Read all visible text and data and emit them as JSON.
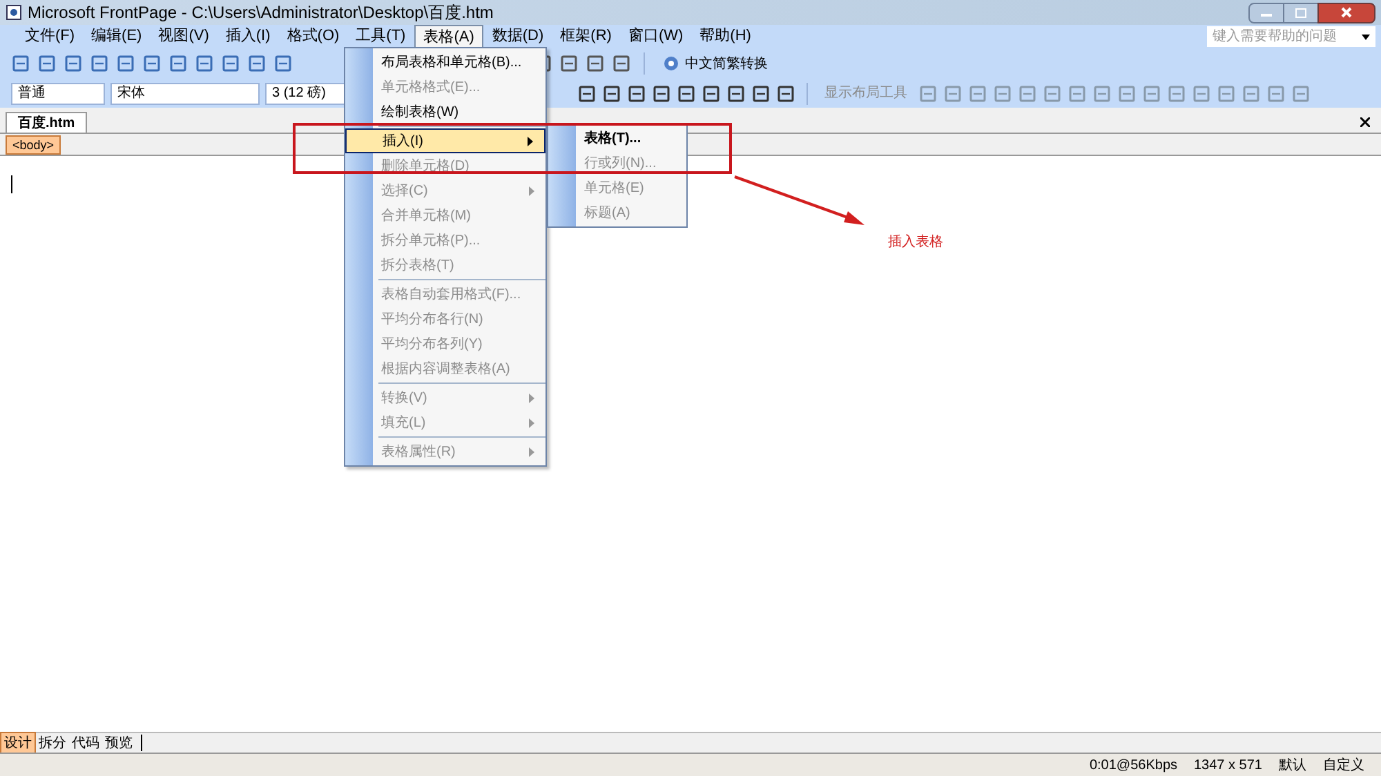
{
  "window": {
    "title": "Microsoft FrontPage - C:\\Users\\Administrator\\Desktop\\百度.htm"
  },
  "menu_bar": [
    {
      "label": "文件(F)",
      "selected": false
    },
    {
      "label": "编辑(E)",
      "selected": false
    },
    {
      "label": "视图(V)",
      "selected": false
    },
    {
      "label": "插入(I)",
      "selected": false
    },
    {
      "label": "格式(O)",
      "selected": false
    },
    {
      "label": "工具(T)",
      "selected": false
    },
    {
      "label": "表格(A)",
      "selected": true
    },
    {
      "label": "数据(D)",
      "selected": false
    },
    {
      "label": "框架(R)",
      "selected": false
    },
    {
      "label": "窗口(W)",
      "selected": false
    },
    {
      "label": "帮助(H)",
      "selected": false
    }
  ],
  "help_search": {
    "placeholder": "键入需要帮助的问题"
  },
  "toolbar": {
    "convert_button": "中文简繁转换"
  },
  "format_bar": {
    "style": "普通",
    "font": "宋体",
    "size": "3 (12 磅)",
    "layout_tools": "显示布局工具"
  },
  "document_tab": {
    "label": "百度.htm"
  },
  "tag_selector": {
    "tag": "<body>"
  },
  "table_menu": [
    {
      "label": "布局表格和单元格(B)...",
      "disabled": false,
      "submenu": false,
      "separator_before": false,
      "selected": false
    },
    {
      "label": "单元格格式(E)...",
      "disabled": true,
      "submenu": false,
      "separator_before": false,
      "selected": false
    },
    {
      "label": "绘制表格(W)",
      "disabled": false,
      "submenu": false,
      "separator_before": false,
      "selected": false
    },
    {
      "label": "插入(I)",
      "disabled": false,
      "submenu": true,
      "separator_before": true,
      "selected": true
    },
    {
      "label": "删除单元格(D)",
      "disabled": true,
      "submenu": false,
      "separator_before": false,
      "selected": false
    },
    {
      "label": "选择(C)",
      "disabled": true,
      "submenu": true,
      "separator_before": false,
      "selected": false
    },
    {
      "label": "合并单元格(M)",
      "disabled": true,
      "submenu": false,
      "separator_before": false,
      "selected": false
    },
    {
      "label": "拆分单元格(P)...",
      "disabled": true,
      "submenu": false,
      "separator_before": false,
      "selected": false
    },
    {
      "label": "拆分表格(T)",
      "disabled": true,
      "submenu": false,
      "separator_before": false,
      "selected": false
    },
    {
      "label": "表格自动套用格式(F)...",
      "disabled": true,
      "submenu": false,
      "separator_before": true,
      "selected": false
    },
    {
      "label": "平均分布各行(N)",
      "disabled": true,
      "submenu": false,
      "separator_before": false,
      "selected": false
    },
    {
      "label": "平均分布各列(Y)",
      "disabled": true,
      "submenu": false,
      "separator_before": false,
      "selected": false
    },
    {
      "label": "根据内容调整表格(A)",
      "disabled": true,
      "submenu": false,
      "separator_before": false,
      "selected": false
    },
    {
      "label": "转换(V)",
      "disabled": true,
      "submenu": true,
      "separator_before": true,
      "selected": false
    },
    {
      "label": "填充(L)",
      "disabled": true,
      "submenu": true,
      "separator_before": false,
      "selected": false
    },
    {
      "label": "表格属性(R)",
      "disabled": true,
      "submenu": true,
      "separator_before": true,
      "selected": false
    }
  ],
  "insert_submenu": [
    {
      "label": "表格(T)...",
      "disabled": false
    },
    {
      "label": "行或列(N)...",
      "disabled": true
    },
    {
      "label": "单元格(E)",
      "disabled": true
    },
    {
      "label": "标题(A)",
      "disabled": true
    }
  ],
  "annotation": {
    "text": "插入表格"
  },
  "view_tabs": [
    {
      "label": "设计",
      "selected": true
    },
    {
      "label": "拆分",
      "selected": false
    },
    {
      "label": "代码",
      "selected": false
    },
    {
      "label": "预览",
      "selected": false
    }
  ],
  "status_bar": [
    "0:01@56Kbps",
    "1347 x 571",
    "默认",
    "自定义"
  ]
}
